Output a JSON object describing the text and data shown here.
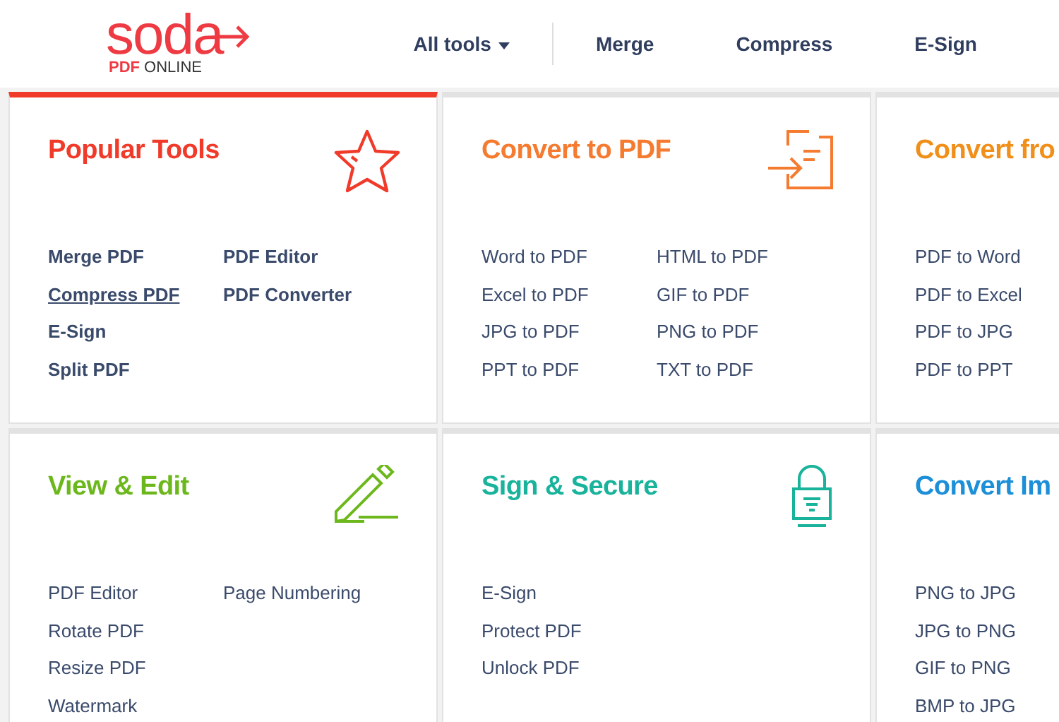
{
  "header": {
    "logo": {
      "name": "soda",
      "tagline": "**PDF** ONLINE"
    },
    "nav": [
      {
        "label": "All tools",
        "dropdown": true
      },
      {
        "label": "Merge",
        "dropdown": false
      },
      {
        "label": "Compress",
        "dropdown": false
      },
      {
        "label": "E-Sign",
        "dropdown": false
      }
    ]
  },
  "cards": [
    {
      "title": "Popular Tools",
      "color": "#f03a2a",
      "highlighted": true,
      "bold_links": true,
      "columns": [
        [
          {
            "label": "Merge PDF",
            "underlined": false
          },
          {
            "label": "Compress PDF",
            "underlined": true
          },
          {
            "label": "E-Sign",
            "underlined": false
          },
          {
            "label": "Split PDF",
            "underlined": false
          }
        ],
        [
          {
            "label": "PDF Editor",
            "underlined": false
          },
          {
            "label": "PDF Converter",
            "underlined": false
          }
        ]
      ]
    },
    {
      "title": "Convert to PDF",
      "color": "#f47b30",
      "highlighted": false,
      "bold_links": false,
      "columns": [
        [
          {
            "label": "Word to PDF",
            "underlined": false
          },
          {
            "label": "Excel to PDF",
            "underlined": false
          },
          {
            "label": "JPG to PDF",
            "underlined": false
          },
          {
            "label": "PPT to PDF",
            "underlined": false
          }
        ],
        [
          {
            "label": "HTML to PDF",
            "underlined": false
          },
          {
            "label": "GIF to PDF",
            "underlined": false
          },
          {
            "label": "PNG to PDF",
            "underlined": false
          },
          {
            "label": "TXT to PDF",
            "underlined": false
          }
        ]
      ]
    },
    {
      "title": "Convert fro",
      "color": "#f0901a",
      "highlighted": false,
      "bold_links": false,
      "columns": [
        [
          {
            "label": "PDF to Word",
            "underlined": false
          },
          {
            "label": "PDF to Excel",
            "underlined": false
          },
          {
            "label": "PDF to JPG",
            "underlined": false
          },
          {
            "label": "PDF to PPT",
            "underlined": false
          }
        ]
      ]
    },
    {
      "title": "View & Edit",
      "color": "#6cb81c",
      "highlighted": false,
      "bold_links": false,
      "columns": [
        [
          {
            "label": "PDF Editor",
            "underlined": false
          },
          {
            "label": "Rotate PDF",
            "underlined": false
          },
          {
            "label": "Resize PDF",
            "underlined": false
          },
          {
            "label": "Watermark",
            "underlined": false
          }
        ],
        [
          {
            "label": "Page Numbering",
            "underlined": false
          }
        ]
      ]
    },
    {
      "title": "Sign & Secure",
      "color": "#19b39c",
      "highlighted": false,
      "bold_links": false,
      "columns": [
        [
          {
            "label": "E-Sign",
            "underlined": false
          },
          {
            "label": "Protect PDF",
            "underlined": false
          },
          {
            "label": "Unlock PDF",
            "underlined": false
          }
        ]
      ]
    },
    {
      "title": "Convert Im",
      "color": "#1c8fd8",
      "highlighted": false,
      "bold_links": false,
      "columns": [
        [
          {
            "label": "PNG to JPG",
            "underlined": false
          },
          {
            "label": "JPG to PNG",
            "underlined": false
          },
          {
            "label": "GIF to PNG",
            "underlined": false
          },
          {
            "label": "BMP to JPG",
            "underlined": false
          }
        ]
      ]
    }
  ]
}
